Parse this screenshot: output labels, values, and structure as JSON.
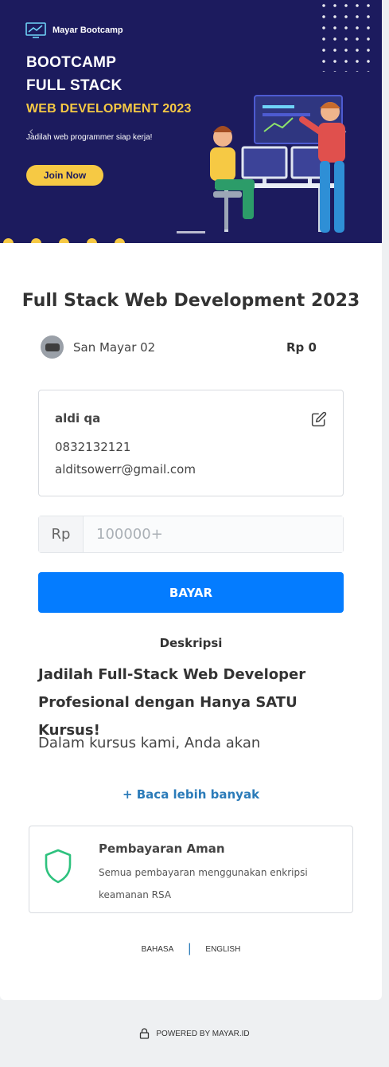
{
  "banner": {
    "brand_name": "Mayar Bootcamp",
    "headline_line1": "BOOTCAMP",
    "headline_line2": "FULL STACK",
    "headline_line3": "WEB DEVELOPMENT 2023",
    "tagline": "Jadilah web programmer siap kerja!",
    "cta_label": "Join Now",
    "prev_arrow": "‹",
    "next_arrow": "›"
  },
  "product": {
    "title": "Full Stack Web Development 2023",
    "seller_name": "San Mayar 02",
    "price": "Rp 0"
  },
  "buyer": {
    "name": "aldi qa",
    "phone": "0832132121",
    "email": "alditsowerr@gmail.com"
  },
  "payment": {
    "currency_prefix": "Rp",
    "amount_placeholder": "100000+",
    "pay_button_label": "BAYAR"
  },
  "description": {
    "heading": "Deskripsi",
    "title": "Jadilah Full-Stack Web Developer Profesional dengan Hanya SATU Kursus!",
    "body": "Dalam kursus kami, Anda akan",
    "read_more": "+ Baca lebih banyak"
  },
  "secure_payment": {
    "title": "Pembayaran Aman",
    "text": "Semua pembayaran menggunakan enkripsi keamanan RSA"
  },
  "language": {
    "label_bahasa": "BAHASA",
    "separator": "|",
    "label_english": "ENGLISH"
  },
  "footer": {
    "powered_by": "POWERED BY MAYAR.ID"
  },
  "colors": {
    "banner_bg": "#1c1b5e",
    "accent_yellow": "#f6c944",
    "primary_button": "#047cff",
    "link": "#2b7bb9",
    "shield": "#2ec27e"
  }
}
